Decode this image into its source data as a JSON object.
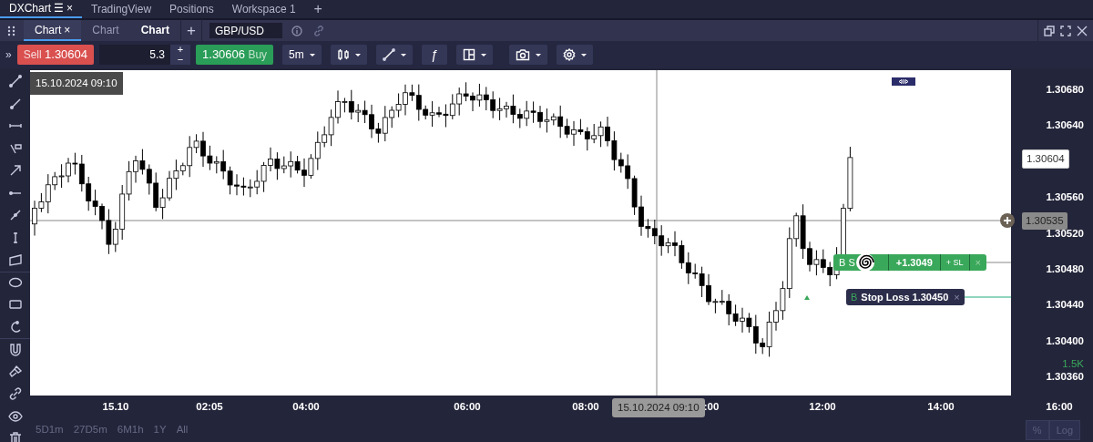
{
  "workspace_tabs": [
    {
      "label": "DXChart",
      "selected": true,
      "menu": "☰",
      "close": "×"
    },
    {
      "label": "TradingView",
      "selected": false
    },
    {
      "label": "Positions",
      "selected": false
    },
    {
      "label": "Workspace 1",
      "selected": false
    }
  ],
  "workspace_add": "+",
  "chart_tabs": [
    {
      "label": "Chart",
      "selected": true,
      "bold": false,
      "close": "×"
    },
    {
      "label": "Chart",
      "selected": false,
      "bold": false
    },
    {
      "label": "Chart",
      "selected": false,
      "bold": true
    }
  ],
  "chart_tab_add": "+",
  "symbol": "GBP/USD",
  "trade_bar": {
    "expand": "»",
    "sell": {
      "label": "Sell",
      "price": "1.30604"
    },
    "quantity": "5.3",
    "increment": "+",
    "decrement": "−",
    "buy": {
      "label": "Buy",
      "price": "1.30606"
    },
    "timeframe": "5m",
    "study": "ƒ"
  },
  "crosshair_time_top": "15.10.2024 09:10",
  "price_axis": {
    "ticks": [
      "1.30680",
      "1.30640",
      "1.30560",
      "1.30520",
      "1.30480",
      "1.30440",
      "1.30400",
      "1.30360"
    ],
    "last_price": "1.30604",
    "crosshair_price": "1.30535",
    "volume": "1.5K"
  },
  "time_axis": {
    "ticks": [
      "15.10",
      "02:05",
      "04:00",
      "06:00",
      "08:00",
      ":00",
      "12:00",
      "14:00",
      "16:00"
    ],
    "crosshair_time": "15.10.2024 09:10"
  },
  "orders": [
    {
      "kind": "position",
      "side": "B",
      "label": "S",
      "pnl": "+1.3049",
      "add_sl": "+ SL",
      "close": "×"
    },
    {
      "kind": "stop",
      "side": "B",
      "label": "Stop Loss 1.30450",
      "close": "×"
    }
  ],
  "ranges": [
    "5D1m",
    "27D5m",
    "6M1h",
    "1Y",
    "All"
  ],
  "scale_buttons": [
    {
      "label": "%",
      "selected": false
    },
    {
      "label": "Log",
      "selected": false
    }
  ]
}
